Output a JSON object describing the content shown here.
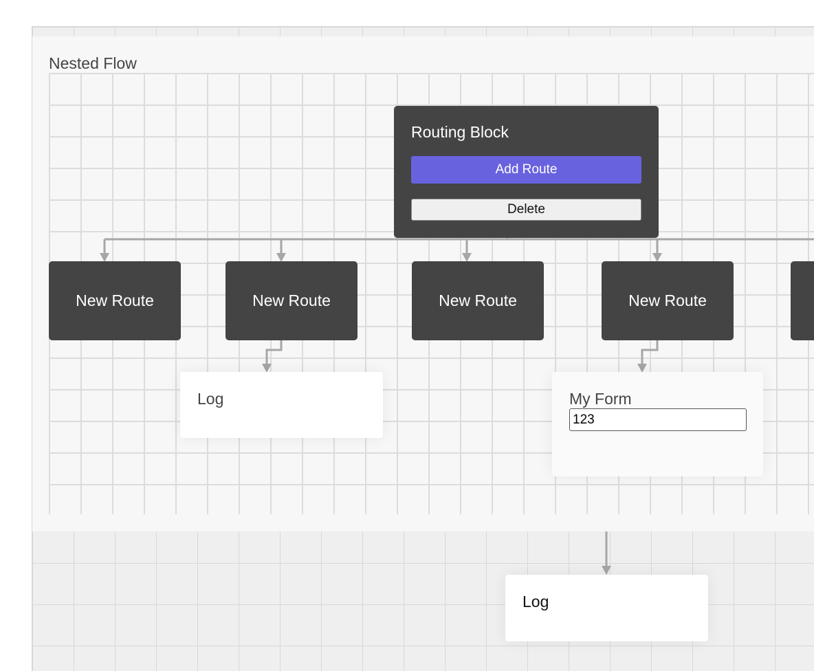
{
  "nested_flow": {
    "title": "Nested Flow"
  },
  "routing_block": {
    "title": "Routing Block",
    "add_route_label": "Add Route",
    "delete_label": "Delete"
  },
  "routes": [
    {
      "label": "New Route"
    },
    {
      "label": "New Route"
    },
    {
      "label": "New Route"
    },
    {
      "label": "New Route"
    }
  ],
  "log_card_inner": {
    "title": "Log"
  },
  "form_card": {
    "title": "My Form",
    "input_value": "123"
  },
  "log_card_outer": {
    "title": "Log"
  },
  "colors": {
    "node_bg": "#444444",
    "accent": "#6962df",
    "connector": "#a6a6a6"
  }
}
